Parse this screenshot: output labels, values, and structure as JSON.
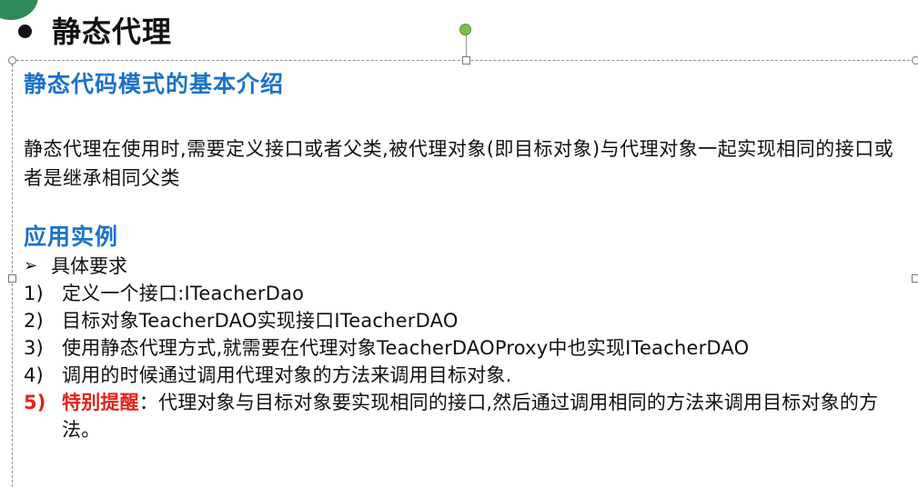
{
  "title": "静态代理",
  "section1": {
    "heading": "静态代码模式的基本介绍",
    "paragraph": "静态代理在使用时,需要定义接口或者父类,被代理对象(即目标对象)与代理对象一起实现相同的接口或者是继承相同父类"
  },
  "section2": {
    "heading": "应用实例",
    "requirement_label": "具体要求",
    "items": [
      {
        "num": "1)",
        "text": "定义一个接口:ITeacherDao"
      },
      {
        "num": "2)",
        "text": "目标对象TeacherDAO实现接口ITeacherDAO"
      },
      {
        "num": "3)",
        "text": "使用静态代理方式,就需要在代理对象TeacherDAOProxy中也实现ITeacherDAO"
      },
      {
        "num": "4)",
        "text": "调用的时候通过调用代理对象的方法来调用目标对象."
      }
    ],
    "note": {
      "num": "5)",
      "label": "特别提醒",
      "separator": "：",
      "text": "代理对象与目标对象要实现相同的接口,然后通过调用相同的方法来调用目标对象的方法。"
    }
  },
  "colors": {
    "heading": "#1a73c9",
    "note": "#e2231a",
    "rotate_handle": "#7cc142"
  },
  "icons": {
    "bullet": "bullet-icon",
    "arrow": "arrow-right-icon"
  }
}
